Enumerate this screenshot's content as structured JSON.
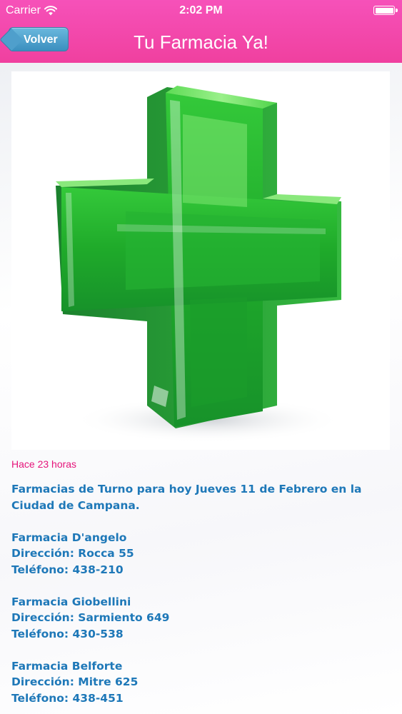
{
  "status_bar": {
    "carrier": "Carrier",
    "time": "2:02 PM",
    "wifi_icon": "wifi-icon",
    "battery_icon": "battery-icon"
  },
  "nav": {
    "back_label": "Volver",
    "title": "Tu Farmacia Ya!"
  },
  "post": {
    "image_icon": "green-pharmacy-cross",
    "timestamp": "Hace 23 horas",
    "intro": "Farmacias de Turno para hoy Jueves 11 de Febrero en la Ciudad de Campana.",
    "pharmacies": [
      {
        "name": "Farmacia D'angelo",
        "address": "Dirección: Rocca 55",
        "phone": "Teléfono: 438-210"
      },
      {
        "name": "Farmacia Giobellini",
        "address": "Dirección: Sarmiento 649",
        "phone": "Teléfono: 430-538"
      },
      {
        "name": "Farmacia Belforte",
        "address": "Dirección: Mitre 625",
        "phone": "Teléfono: 438-451"
      }
    ]
  },
  "colors": {
    "bar_pink": "#f0409f",
    "back_button_blue": "#3b8fbf",
    "timestamp_pink": "#e5147a",
    "body_text_blue": "#1e78b8",
    "cross_green": "#2fc23a"
  }
}
